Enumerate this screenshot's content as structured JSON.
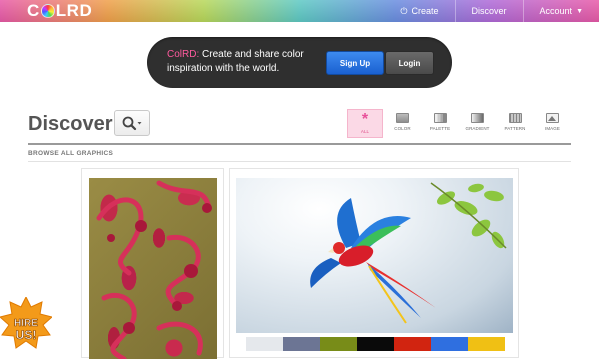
{
  "header": {
    "logo": {
      "pre": "C",
      "post": "LRD"
    },
    "nav": [
      {
        "label": "Create",
        "icon": "power-icon"
      },
      {
        "label": "Discover"
      },
      {
        "label": "Account",
        "icon": "caret-down-icon"
      }
    ]
  },
  "hero": {
    "brand": "ColRD:",
    "text": " Create and share color inspiration with the world.",
    "signup_label": "Sign Up",
    "login_label": "Login"
  },
  "discover": {
    "title": "Discover",
    "filters": [
      {
        "label": "ALL",
        "icon": "star-icon",
        "active": true
      },
      {
        "label": "COLOR",
        "icon": "color-icon"
      },
      {
        "label": "PALETTE",
        "icon": "palette-icon"
      },
      {
        "label": "GRADIENT",
        "icon": "gradient-icon"
      },
      {
        "label": "PATTERN",
        "icon": "pattern-icon"
      },
      {
        "label": "IMAGE",
        "icon": "image-icon"
      }
    ],
    "section_label": "BROWSE ALL GRAPHICS"
  },
  "cards": {
    "palette_colors": [
      "#e5e8ec",
      "#6c7594",
      "#788c18",
      "#0a0a0a",
      "#d12410",
      "#2f6fe0",
      "#f0c014"
    ]
  },
  "badge": {
    "line1": "HIRE",
    "line2": "US!"
  },
  "colors": {
    "accent": "#e8509a",
    "signup_blue": "#2a70e0",
    "hero_bg": "#2f2f2f"
  }
}
